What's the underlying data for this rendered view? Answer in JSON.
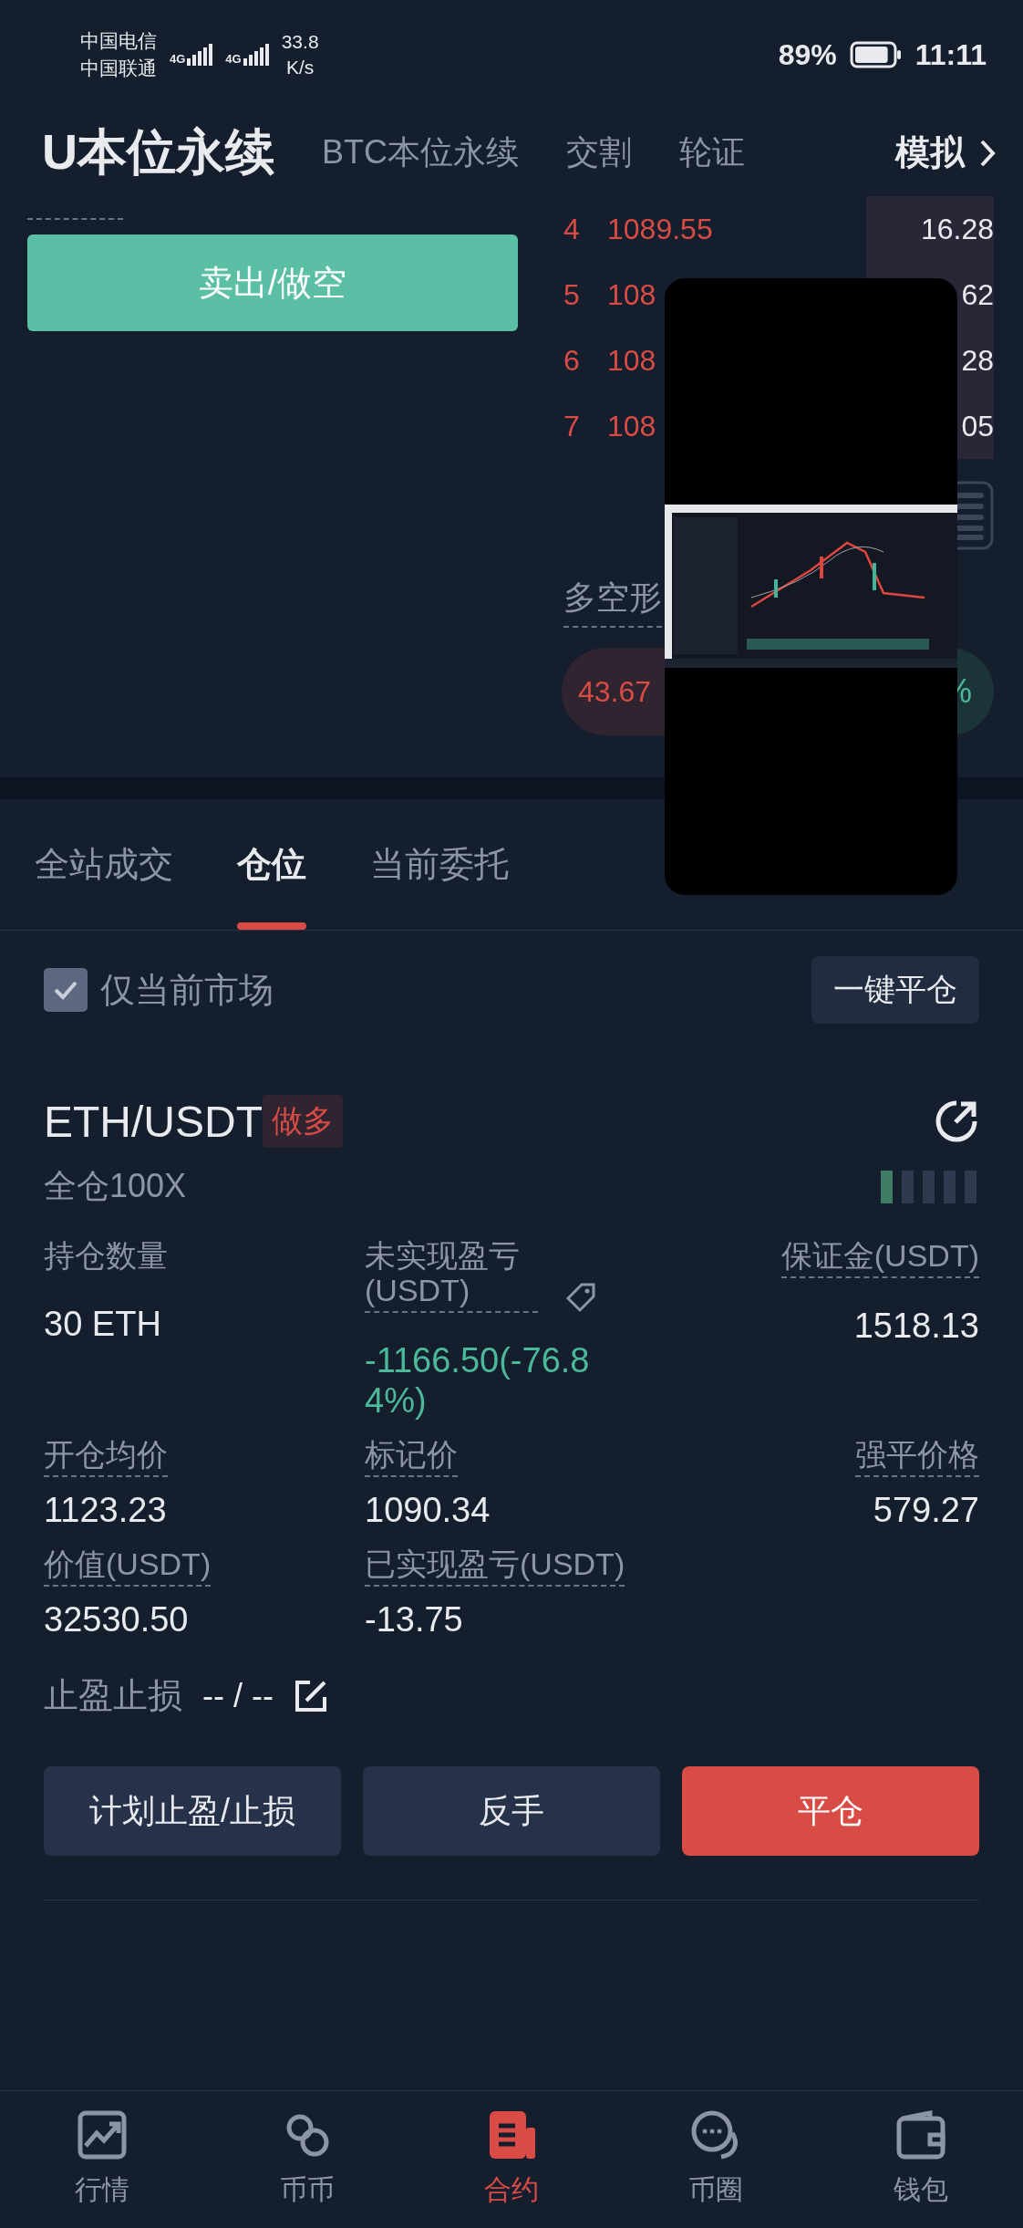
{
  "status_bar": {
    "carrier_1": "中国电信",
    "carrier_2": "中国联通",
    "network_1": "4G",
    "network_2": "4G",
    "speed": "33.8",
    "speed_unit": "K/s",
    "battery": "89%",
    "time": "11:11"
  },
  "top_tabs": [
    {
      "label": "U本位永续",
      "selected": true
    },
    {
      "label": "BTC本位永续",
      "selected": false
    },
    {
      "label": "交割",
      "selected": false
    },
    {
      "label": "轮证",
      "selected": false
    }
  ],
  "simulate": {
    "label": "模拟"
  },
  "sell_button": "卖出/做空",
  "order_book": [
    {
      "index": "4",
      "price": "1089.55",
      "amount": "16.28"
    },
    {
      "index": "5",
      "price": "108",
      "amount": "62"
    },
    {
      "index": "6",
      "price": "108",
      "amount": "28"
    },
    {
      "index": "7",
      "price": "108",
      "amount": "05"
    }
  ],
  "long_short": {
    "label": "多空形",
    "long": "43.67",
    "short": "%"
  },
  "section_tabs": [
    {
      "label": "全站成交",
      "selected": false
    },
    {
      "label": "仓位",
      "selected": true
    },
    {
      "label": "当前委托",
      "selected": false
    }
  ],
  "filter": {
    "label": "仅当前市场",
    "checked": true
  },
  "close_all_button": "一键平仓",
  "position": {
    "symbol": "ETH/USDT",
    "side": "做多",
    "margin_mode": "全仓100X",
    "fields": [
      {
        "label": "持仓数量",
        "value": "30 ETH",
        "dashed": false,
        "emphasis": false
      },
      {
        "label": "未实现盈亏(USDT)",
        "value": "-1166.50(-76.84%)",
        "dashed": true,
        "emphasis": true
      },
      {
        "label": "保证金(USDT)",
        "value": "1518.13",
        "dashed": true,
        "emphasis": false
      },
      {
        "label": "开仓均价",
        "value": "1123.23",
        "dashed": true,
        "emphasis": false
      },
      {
        "label": "标记价",
        "value": "1090.34",
        "dashed": true,
        "emphasis": false
      },
      {
        "label": "强平价格",
        "value": "579.27",
        "dashed": true,
        "emphasis": false
      },
      {
        "label": "价值(USDT)",
        "value": "32530.50",
        "dashed": true,
        "emphasis": false
      },
      {
        "label": "已实现盈亏(USDT)",
        "value": "-13.75",
        "dashed": true,
        "emphasis": false
      }
    ],
    "tp_sl_label": "止盈止损",
    "tp_sl_value": "-- / --",
    "actions": [
      {
        "label": "计划止盈/止损",
        "kind": "secondary"
      },
      {
        "label": "反手",
        "kind": "secondary"
      },
      {
        "label": "平仓",
        "kind": "danger"
      }
    ]
  },
  "bottom_nav": [
    {
      "label": "行情",
      "selected": false
    },
    {
      "label": "币币",
      "selected": false
    },
    {
      "label": "合约",
      "selected": true
    },
    {
      "label": "币圈",
      "selected": false
    },
    {
      "label": "钱包",
      "selected": false
    }
  ]
}
